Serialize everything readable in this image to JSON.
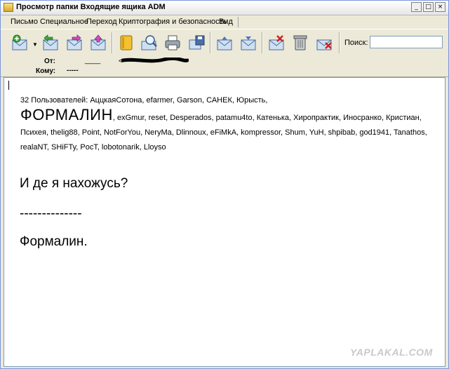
{
  "window": {
    "title": "Просмотр папки Входящие ящика ADM"
  },
  "menu": [
    {
      "label": "Письмо"
    },
    {
      "label": "Специальное"
    },
    {
      "label": "Переход"
    },
    {
      "label": "Криптография и безопасность"
    },
    {
      "label": "Вид"
    }
  ],
  "toolbar": {
    "buttons": [
      {
        "name": "new-message-icon"
      },
      {
        "name": "reply-icon"
      },
      {
        "name": "forward-icon"
      },
      {
        "name": "send-icon"
      },
      {
        "name": "address-book-icon"
      },
      {
        "name": "find-icon"
      },
      {
        "name": "print-icon"
      },
      {
        "name": "save-icon"
      },
      {
        "name": "move-up-icon"
      },
      {
        "name": "move-down-icon"
      },
      {
        "name": "delete-message-icon"
      },
      {
        "name": "trash-icon"
      },
      {
        "name": "spam-icon"
      }
    ],
    "search_label": "Поиск:",
    "search_value": ""
  },
  "header": {
    "from_label": "От:",
    "from_value": "____",
    "from_address_prefix": "<",
    "to_label": "Кому:",
    "to_value": "-----"
  },
  "message": {
    "users_lead": "32 Пользователей: АццкаяСотона, efarmer, Garson, САНЕК, Юрысть,",
    "users_big": "ФОРМАЛИН",
    "users_rest": ", exGmur, reset, Desperados, patamu4to, Катенька, Хиропрактик, Иносранко, Кристиан, Психея, thelig88, Point, NotForYou, NeryMa, Dlinnoux, eFiMkA, kompressor, Shum, YuH, shpibab, god1941, Tanathos, realaNT, SHiFTy, PocT, lobotonarik, Lloyso",
    "question": "И де я нахожусь?",
    "divider": "--------------",
    "signature": "Формалин."
  },
  "watermark": "YAPLAKAL.COM"
}
